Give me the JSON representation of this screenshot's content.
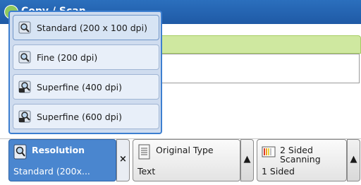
{
  "screen": {
    "title": "Copy / Scan"
  },
  "popup": {
    "options": [
      {
        "label": "Standard (200 x 100 dpi)",
        "icon": "magnifier-icon",
        "selected": true
      },
      {
        "label": "Fine (200 dpi)",
        "icon": "magnifier-icon",
        "selected": false
      },
      {
        "label": "Superfine (400 dpi)",
        "icon": "magnifier-400-icon",
        "selected": false
      },
      {
        "label": "Superfine (600 dpi)",
        "icon": "magnifier-600-icon",
        "selected": false
      }
    ]
  },
  "features": {
    "resolution": {
      "title": "Resolution",
      "value": "Standard (200x...",
      "close_glyph": "×"
    },
    "original_type": {
      "title": "Original Type",
      "value": "Text",
      "arrow_glyph": "▲"
    },
    "two_sided": {
      "title": "2 Sided Scanning",
      "value": "1 Sided",
      "arrow_glyph": "▲"
    }
  },
  "colors": {
    "accent_blue": "#4a86cf",
    "popup_border": "#3d7fd0",
    "green_bar": "#cfe8a0",
    "titlebar": "#1f5aa6"
  }
}
